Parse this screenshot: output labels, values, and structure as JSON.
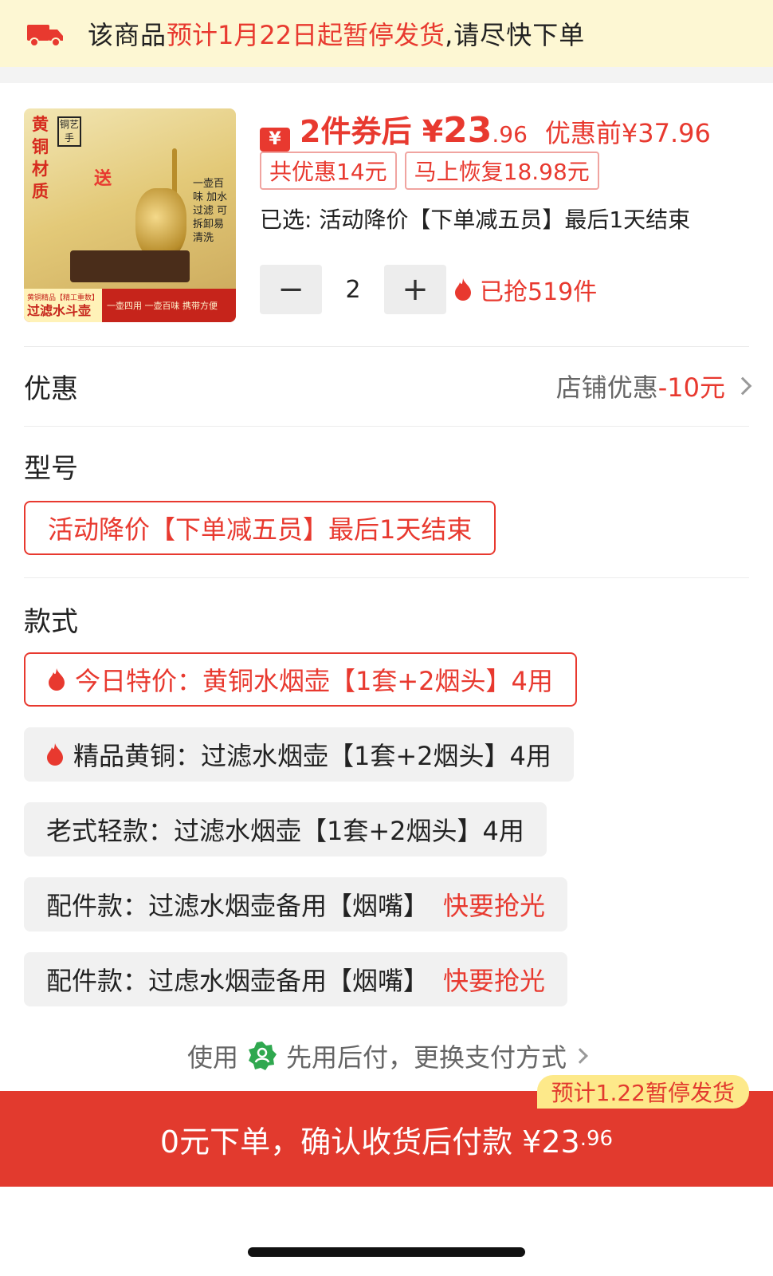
{
  "notice": {
    "prefix": "该商品",
    "highlight": "预计1月22日起暂停发货",
    "suffix": ",请尽快下单",
    "icon": "truck-icon"
  },
  "product": {
    "thumbnail": {
      "title_chars": "黄铜材质",
      "seal_text": "铜艺手",
      "gift": "送",
      "vertical_text": "一壶百味 加水过滤 可拆卸易清洗",
      "banner_small": "黄铜精品【精工重数】",
      "banner_big": "过滤水斗壶",
      "banner_right": "一壶四用 一壶百味 携带方便"
    },
    "coupon_icon_text": "¥",
    "price_prefix": "2件券后",
    "price_symbol": "¥",
    "price_integer": "23",
    "price_decimal": ".96",
    "original_price": "优惠前¥37.96",
    "tags": [
      "共优惠14元",
      "马上恢复18.98元"
    ],
    "selected": "已选: 活动降价【下单减五员】最后1天结束",
    "quantity": {
      "minus": "−",
      "value": "2",
      "plus": "+"
    },
    "sold": "已抢519件"
  },
  "discount": {
    "label": "优惠",
    "shop": "店铺优惠",
    "amount": "-10元"
  },
  "model": {
    "label": "型号",
    "option": "活动降价【下单减五员】最后1天结束"
  },
  "style": {
    "label": "款式",
    "options": [
      {
        "text": "今日特价：黄铜水烟壶【1套+2烟头】4用",
        "hot": true,
        "selected": true
      },
      {
        "text": "精品黄铜：过滤水烟壶【1套+2烟头】4用",
        "hot": true,
        "selected": false
      },
      {
        "text": "老式轻款：过滤水烟壶【1套+2烟头】4用",
        "hot": false,
        "selected": false
      },
      {
        "text": "配件款：过滤水烟壶备用【烟嘴】",
        "tag": "快要抢光"
      },
      {
        "text": "配件款：过虑水烟壶备用【烟嘴】",
        "tag": "快要抢光"
      }
    ]
  },
  "payment": {
    "use": "使用",
    "method": "先用后付，更换支付方式"
  },
  "cta": {
    "badge": "预计1.22暂停发货",
    "text": "0元下单，确认收货后付款 ¥23",
    "decimal": ".96"
  },
  "colors": {
    "accent": "#e8392f",
    "notice_bg": "#fdf7d3",
    "cta_bg": "#e23a2e",
    "badge_bg": "#fde98a"
  }
}
